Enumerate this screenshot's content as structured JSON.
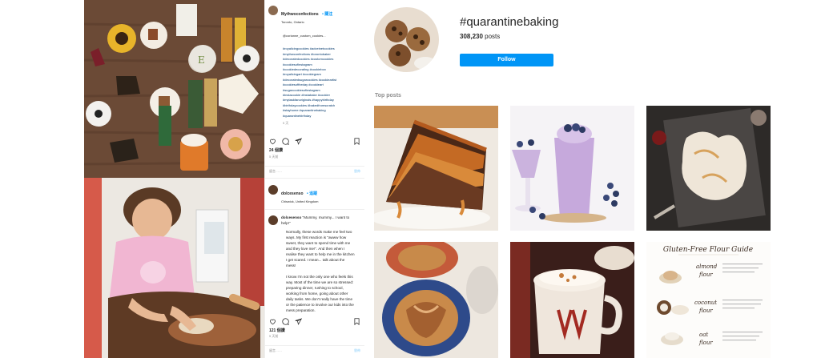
{
  "post1": {
    "username": "Mythwoconfections",
    "follow_label": "• 關注",
    "location": "Toronto, Ontario",
    "mention": "@corianne_custom_cookies...",
    "hashtags": "#royalicingcookies #adveinetcookies\n#mythwconfections #torontobaker\n#decoratedcookies #customcookies\n#cookiesofinstagram\n#cookiedecorating #cookiebox\n#royalicingart #cookiegram\n#decoratedsugarcookies #cookieartist\n#cookiesoftheday #cookieart\n#sugarcookiesofinstagram\n#instacookie #instabake #cookier\n#mytaskfanoriginals #happybirthday\n#birthdaycookies #bakedfromscratch\n#stayhome #quarantinebaking\n#quarantinebirthday",
    "age": "5 天",
    "likes": "24 個讚",
    "date": "5 天前",
    "comment_placeholder": "留言……",
    "post_label": "發佈"
  },
  "post2": {
    "username": "dolcesenso",
    "follow_label": "• 追蹤",
    "location": "Chiswick, United Kingdom",
    "comment_username": "dolcesenso",
    "comment_lead": " \"Mummy, mummy... I want to help!\"",
    "comment_body": "Normally, these words make me feel two ways. My first reaction is \"awww how sweet, they want to spend time with me and they love me!\". And then when I realise they want to help me in the kitchen I get scared. I mean... talk about the mess!\n\nI know I'm not the only one who feels this way. Most of the time we are so stressed: preparing dinner, rushing to school, working from home, going about other daily tasks. We don't really have the time or the patience to involve our kids into the mess preparation.",
    "likes": "121 個讚",
    "date": "5 天前",
    "comment_placeholder": "留言……",
    "post_label": "發佈"
  },
  "hashtag": {
    "title": "#quarantinebaking",
    "count": "308,230",
    "count_label": " posts",
    "follow_label": "Follow",
    "top_posts_label": "Top posts"
  },
  "flour_guide": {
    "title": "Gluten-Free Flour Guide",
    "items": [
      {
        "name": "almond",
        "name2": "flour"
      },
      {
        "name": "coconut",
        "name2": "flour"
      },
      {
        "name": "oat",
        "name2": "flour"
      }
    ]
  },
  "colors": {
    "accent": "#0095f6",
    "text": "#262626",
    "muted": "#8e8e8e"
  }
}
